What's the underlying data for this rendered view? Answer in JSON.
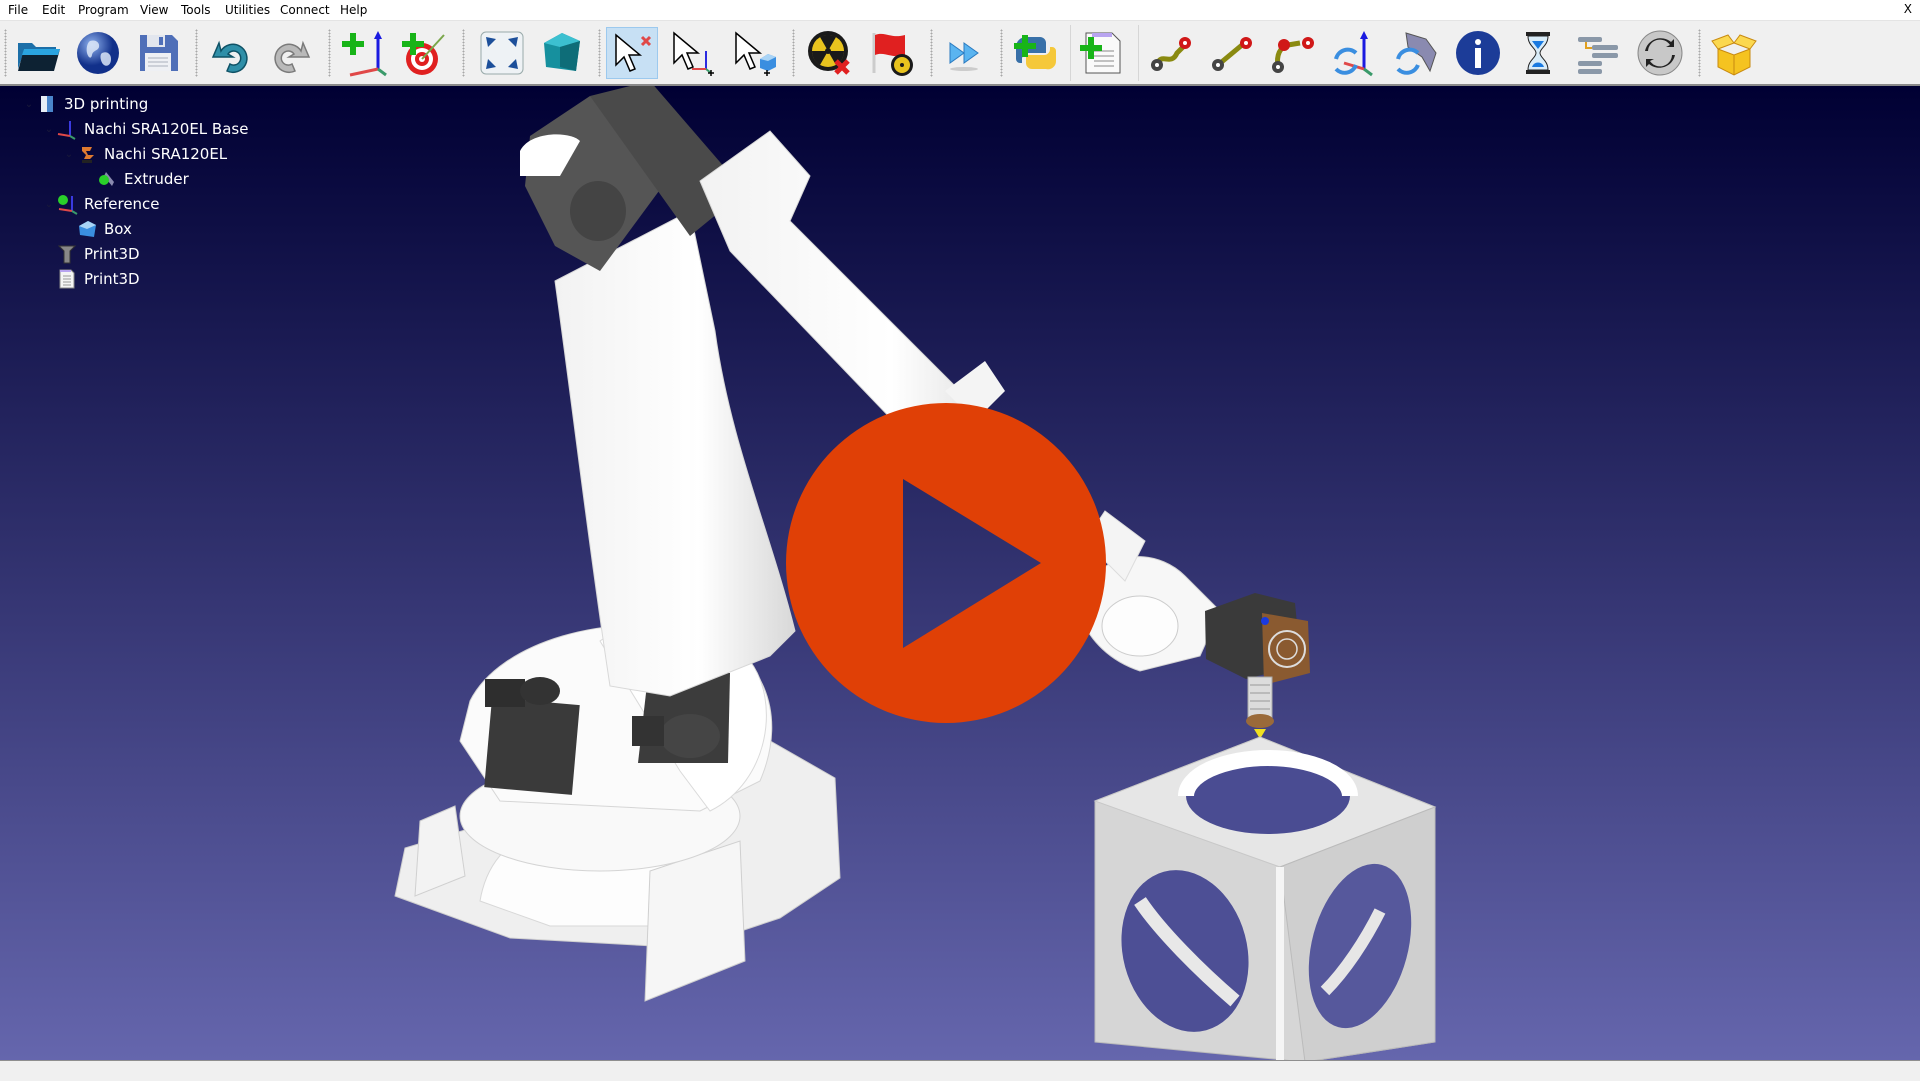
{
  "menu": {
    "items": [
      "File",
      "Edit",
      "Program",
      "View",
      "Tools",
      "Utilities",
      "Connect",
      "Help"
    ],
    "close_label": "X"
  },
  "toolbar": {
    "buttons": [
      {
        "name": "open-file",
        "icon": "folder-icon"
      },
      {
        "name": "open-online-library",
        "icon": "globe-icon"
      },
      {
        "name": "save",
        "icon": "floppy-disk-icon"
      },
      {
        "name": "undo",
        "icon": "undo-arrow-icon"
      },
      {
        "name": "redo",
        "icon": "redo-arrow-icon"
      },
      {
        "name": "add-reference-frame",
        "icon": "add-frame-icon"
      },
      {
        "name": "add-target",
        "icon": "add-target-icon"
      },
      {
        "name": "fit-all",
        "icon": "fit-view-icon"
      },
      {
        "name": "isometric-view",
        "icon": "cube-view-icon"
      },
      {
        "name": "select-default",
        "icon": "cursor-deselect-icon",
        "active": true
      },
      {
        "name": "move-reference",
        "icon": "cursor-move-frame-icon"
      },
      {
        "name": "move-object",
        "icon": "cursor-move-object-icon"
      },
      {
        "name": "check-collisions-off",
        "icon": "radiation-cross-icon"
      },
      {
        "name": "collision-flag",
        "icon": "radiation-flag-icon"
      },
      {
        "name": "fast-simulation",
        "icon": "fast-forward-icon"
      },
      {
        "name": "add-python-program",
        "icon": "python-add-icon"
      },
      {
        "name": "add-program",
        "icon": "program-add-icon"
      },
      {
        "name": "move-joint-instruction",
        "icon": "joint-move-icon"
      },
      {
        "name": "move-linear-instruction",
        "icon": "linear-move-icon"
      },
      {
        "name": "move-circular-instruction",
        "icon": "circular-move-icon"
      },
      {
        "name": "set-reference-frame",
        "icon": "frame-sync-icon"
      },
      {
        "name": "set-tool-frame",
        "icon": "tool-sync-icon"
      },
      {
        "name": "show-message",
        "icon": "info-icon"
      },
      {
        "name": "pause",
        "icon": "hourglass-icon"
      },
      {
        "name": "program-call",
        "icon": "program-call-icon"
      },
      {
        "name": "set-digital-output",
        "icon": "io-sync-icon"
      },
      {
        "name": "open-package",
        "icon": "package-box-icon"
      }
    ]
  },
  "tree": {
    "items": [
      {
        "label": "3D printing",
        "icon": "station-icon",
        "level": 0,
        "expanded": true
      },
      {
        "label": "Nachi SRA120EL Base",
        "icon": "reference-frame-icon",
        "level": 1,
        "expanded": true
      },
      {
        "label": "Nachi SRA120EL",
        "icon": "robot-icon",
        "level": 2,
        "expanded": true
      },
      {
        "label": "Extruder",
        "icon": "tool-icon",
        "level": 3,
        "expanded": false
      },
      {
        "label": "Reference",
        "icon": "reference-frame-icon",
        "level": 1,
        "expanded": true
      },
      {
        "label": "Box",
        "icon": "object-icon",
        "level": 2,
        "expanded": false
      },
      {
        "label": "Print3D",
        "icon": "machining-project-icon",
        "level": 1,
        "expanded": false
      },
      {
        "label": "Print3D",
        "icon": "program-icon",
        "level": 1,
        "expanded": false
      }
    ]
  },
  "viewport": {
    "gradient_top": "#000033",
    "gradient_bottom": "#6566ad"
  },
  "overlay": {
    "play_button_color": "#e04006",
    "play_icon": "play-icon"
  }
}
